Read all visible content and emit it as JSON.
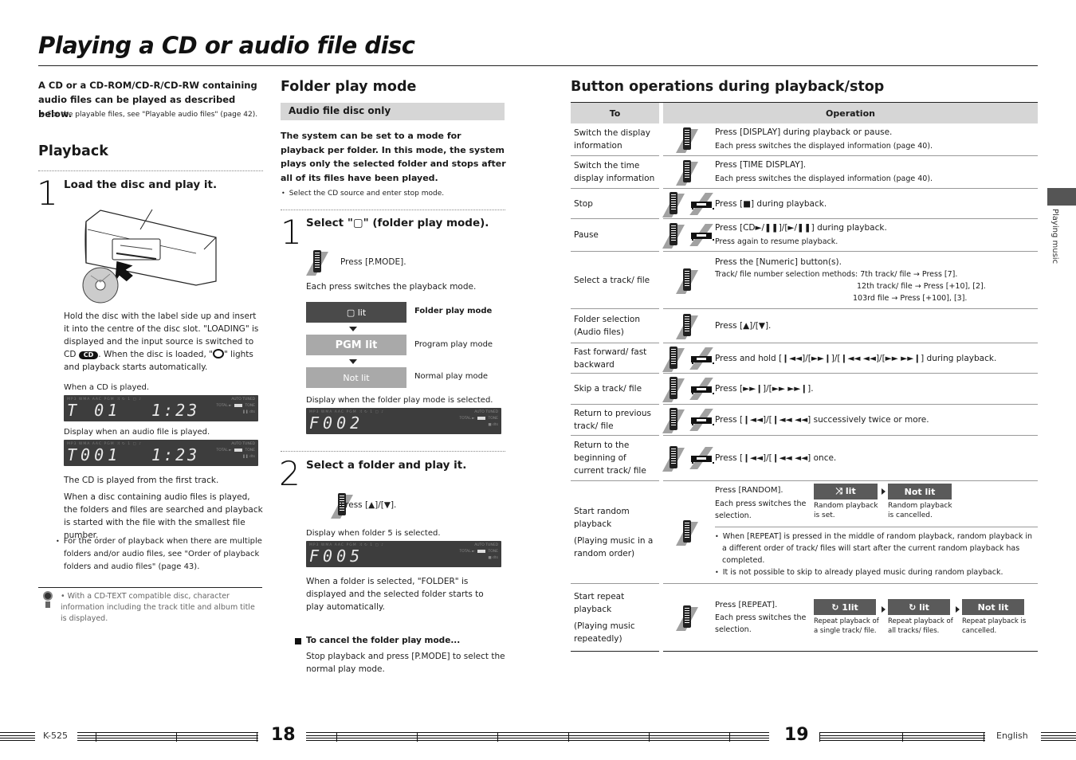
{
  "page_title": "Playing a CD or audio file disc",
  "left": {
    "intro": "A CD or a CD-ROM/CD-R/CD-RW containing audio files can be played as described below.",
    "intro_note": "For the playable files, see \"Playable audio files\" (page 42).",
    "playback_heading": "Playback",
    "step1_num": "1",
    "step1_title": "Load the disc and play it.",
    "step1_body_a": "Hold the disc with the label side up and insert it into the centre of the disc slot. \"LOADING\" is displayed and the input source is switched to CD",
    "cd_badge": "CD",
    "step1_body_b": ". When the disc is loaded, \"",
    "step1_body_c": "\" lights and playback starts automatically.",
    "cd_played_caption": "When a CD is played.",
    "lcd_cd": {
      "top": "MP3  WMA  AAC        PGM  ⤨  ↻  1   ▢  ♪",
      "main": "T 01",
      "time": "1:23"
    },
    "audio_played_caption": "Display when an audio file is played.",
    "lcd_audio": {
      "top": "MP3  WMA  AAC        PGM  ⤨  ↻  1   ▢  ♪",
      "main": "T001",
      "time": "1:23"
    },
    "first_track": "The CD is played from the first track.",
    "audio_files_body": "When a disc containing audio files is played, the folders and files are searched and playback is started with the file with the smallest file number.",
    "order_note": "For the order of playback when there are multiple folders and/or audio files, see \"Order of playback folders and audio files\" (page 43).",
    "tip": "With a CD-TEXT compatible disc, character information including the track title and album title is displayed."
  },
  "middle": {
    "heading": "Folder play mode",
    "badge": "Audio file disc only",
    "intro": "The system can be set to a mode for playback per folder. In this mode, the system plays only the selected folder and stops after all of its files have been played.",
    "intro_note": "Select the CD source and enter stop mode.",
    "step1_num": "1",
    "step1_title": "Select \"▢\" (folder play mode).",
    "press_pmode": "Press [P.MODE].",
    "each_press": "Each press switches the playback mode.",
    "modes": [
      {
        "box": "▢  lit",
        "label": "Folder play mode"
      },
      {
        "box": "PGM  lit",
        "label": "Program play mode"
      },
      {
        "box": "Not lit",
        "label": "Normal play mode"
      }
    ],
    "folder_caption": "Display when the folder play mode is selected.",
    "lcd_f002": {
      "top": "MP3  WMA  AAC        PGM  ⤨  ↻  1   ▢  ♪",
      "main": "F002"
    },
    "step2_num": "2",
    "step2_title": "Select a folder and play it.",
    "press_updown": "Press [▲]/[▼].",
    "folder5_caption": "Display when folder 5 is selected.",
    "lcd_f005": {
      "top": "MP3  WMA  AAC        PGM  ⤨  ↻  1   ▢  ♪",
      "main": "F005"
    },
    "folder_selected_body": "When a folder is selected, \"FOLDER\" is displayed and the selected folder starts to play automatically.",
    "cancel_title": "To cancel the folder play mode...",
    "cancel_body": "Stop playback and press [P.MODE] to select the normal play mode."
  },
  "right": {
    "heading": "Button operations during playback/stop",
    "col_to": "To",
    "col_operation": "Operation",
    "rows": [
      {
        "to": "Switch the display information",
        "icons": "remote",
        "op": "Press [DISPLAY] during playback or pause.",
        "sub": "Each press switches the displayed information (page 40)."
      },
      {
        "to": "Switch the time display information",
        "icons": "remote",
        "op": "Press [TIME DISPLAY].",
        "sub": "Each press switches the displayed information (page 40)."
      },
      {
        "to": "Stop",
        "icons": "remote+unit",
        "op": "Press [■] during playback.",
        "sub": ""
      },
      {
        "to": "Pause",
        "icons": "remote+unit",
        "op": "Press [CD►/❚❚]/[►/❚❚] during playback.",
        "sub": "Press again to resume playback."
      },
      {
        "to": "Select a track/ file",
        "icons": "remote",
        "op": "Press the [Numeric] button(s).",
        "sub": "Track/ file number selection methods:  7th track/ file → Press [7].",
        "sub2": "12th track/ file → Press [+10], [2].",
        "sub3": "103rd file → Press [+100], [3]."
      },
      {
        "to": "Folder selection (Audio files)",
        "icons": "remote",
        "op": "Press [▲]/[▼].",
        "sub": ""
      },
      {
        "to": "Fast forward/ fast backward",
        "icons": "remote+unit",
        "op": "Press and hold [❙◄◄]/[►►❙]/[❙◄◄ ◄◄]/[►► ►►❙] during playback.",
        "sub": ""
      },
      {
        "to": "Skip a track/ file",
        "icons": "remote+unit",
        "op": "Press [►►❙]/[►► ►►❙].",
        "sub": ""
      },
      {
        "to": "Return to previous track/ file",
        "icons": "remote+unit",
        "op": "Press [❙◄◄]/[❙◄◄ ◄◄] successively twice or more.",
        "sub": ""
      },
      {
        "to": "Return to the beginning of current track/ file",
        "icons": "remote+unit",
        "op": "Press [❙◄◄]/[❙◄◄ ◄◄] once.",
        "sub": ""
      }
    ],
    "random": {
      "to": "Start random playback",
      "to_sub": "(Playing music in a random order)",
      "press": "Press [RANDOM].",
      "each": "Each press switches the selection.",
      "states": [
        {
          "box": "⤨ lit",
          "caption": "Random playback is set."
        },
        {
          "box": "Not lit",
          "caption": "Random playback is cancelled."
        }
      ],
      "notes": [
        "When [REPEAT] is pressed in the middle of random playback, random playback in a different order of track/ files will start after the current random playback has completed.",
        "It is not possible to skip to already played music during random playback."
      ]
    },
    "repeat": {
      "to": "Start repeat playback",
      "to_sub": "(Playing music repeatedly)",
      "press": "Press [REPEAT].",
      "each": "Each press switches the selection.",
      "states": [
        {
          "box": "↻ 1lit",
          "caption": "Repeat playback of a single track/ file."
        },
        {
          "box": "↻ lit",
          "caption": "Repeat playback of all tracks/ files."
        },
        {
          "box": "Not lit",
          "caption": "Repeat playback is cancelled."
        }
      ]
    }
  },
  "side_tab": "Playing music",
  "footer": {
    "model": "K-525",
    "page_left": "18",
    "page_right": "19",
    "language": "English"
  }
}
